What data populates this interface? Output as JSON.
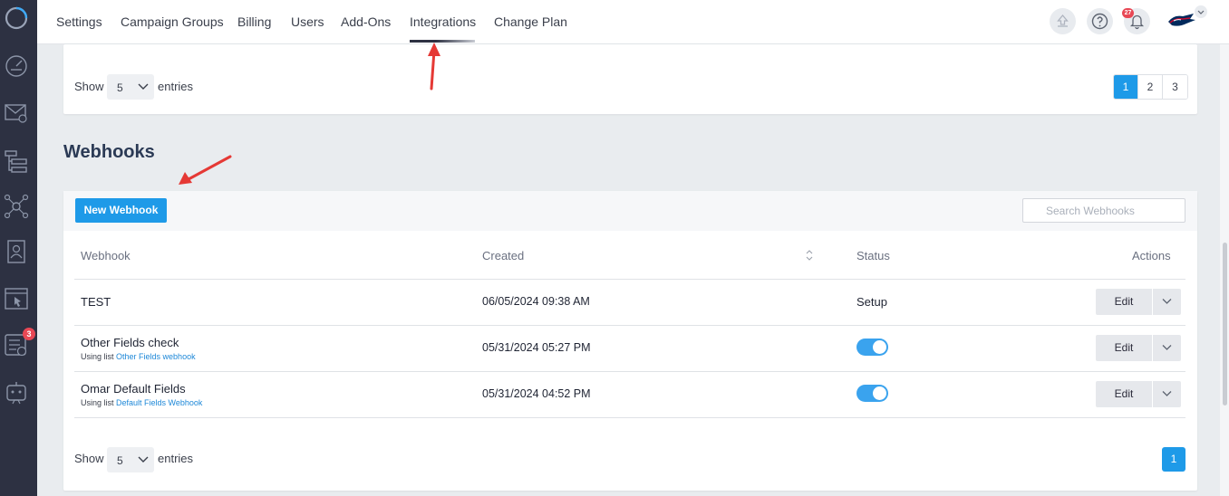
{
  "nav": {
    "items": [
      "Settings",
      "Campaign Groups",
      "Billing",
      "Users",
      "Add-Ons",
      "Integrations",
      "Change Plan"
    ],
    "active": "Integrations"
  },
  "header": {
    "notification_count": "27"
  },
  "sidebar": {
    "badge_count": "3",
    "icons": [
      "logo-icon",
      "dashboard-icon",
      "email-campaign-icon",
      "hierarchy-icon",
      "network-icon",
      "contacts-icon",
      "landing-page-icon",
      "tasks-icon",
      "bot-icon"
    ]
  },
  "top_card": {
    "show_label": "Show",
    "entries_label": "entries",
    "page_size": "5",
    "pages": [
      "1",
      "2",
      "3"
    ],
    "active_page": "1"
  },
  "webhooks": {
    "title": "Webhooks",
    "new_button": "New Webhook",
    "search_placeholder": "Search Webhooks",
    "columns": {
      "webhook": "Webhook",
      "created": "Created",
      "status": "Status",
      "actions": "Actions"
    },
    "rows": [
      {
        "name": "TEST",
        "list_prefix": "",
        "list_name": "",
        "created": "06/05/2024 09:38 AM",
        "status": "Setup",
        "status_type": "text",
        "action": "Edit"
      },
      {
        "name": "Other Fields check",
        "list_prefix": "Using list",
        "list_name": "Other Fields webhook",
        "created": "05/31/2024 05:27 PM",
        "status": "",
        "status_type": "toggle-on",
        "action": "Edit"
      },
      {
        "name": "Omar Default Fields",
        "list_prefix": "Using list",
        "list_name": "Default Fields Webhook",
        "created": "05/31/2024 04:52 PM",
        "status": "",
        "status_type": "toggle-on",
        "action": "Edit"
      }
    ],
    "footer": {
      "show_label": "Show",
      "entries_label": "entries",
      "page_size": "5",
      "pages": [
        "1"
      ]
    }
  },
  "colors": {
    "accent": "#1e9ae8",
    "sidebar": "#2d3142",
    "badge": "#e84855",
    "annotation_arrow": "#e53935"
  }
}
